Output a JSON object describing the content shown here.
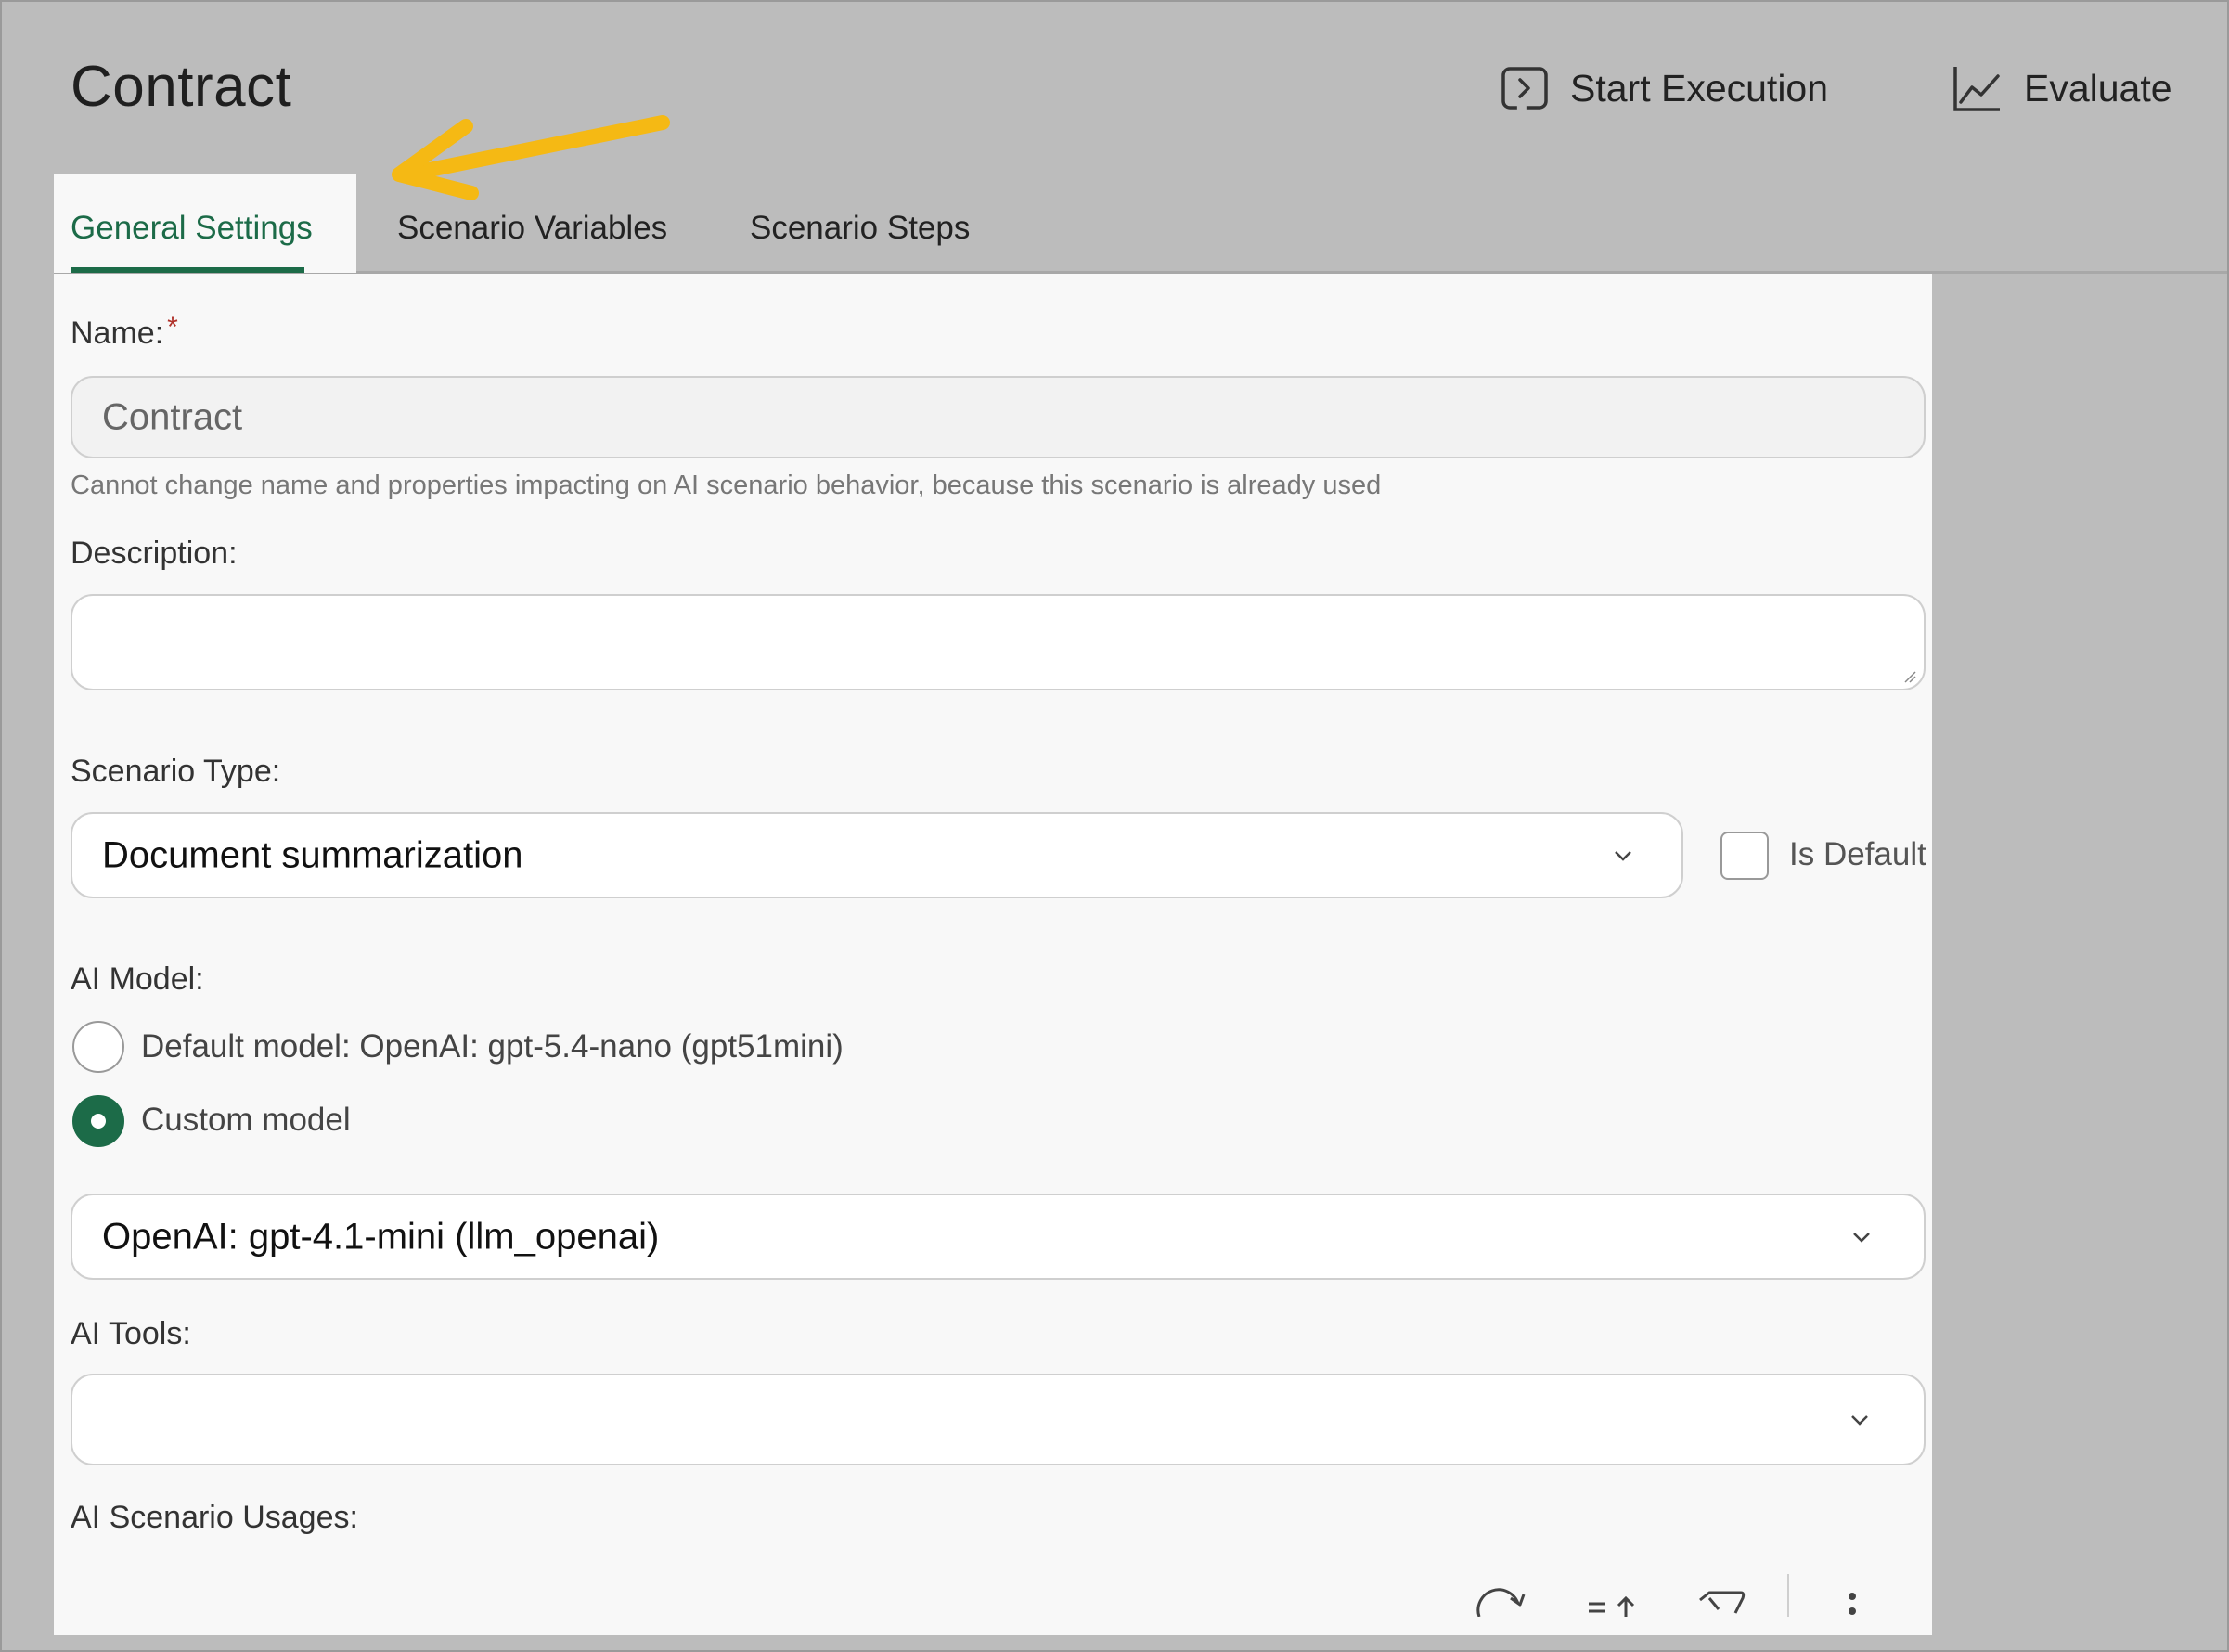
{
  "header": {
    "title": "Contract",
    "actions": {
      "start_execution": "Start Execution",
      "evaluate": "Evaluate"
    }
  },
  "tabs": {
    "general": "General Settings",
    "variables": "Scenario Variables",
    "steps": "Scenario Steps",
    "active": "General Settings"
  },
  "form": {
    "name": {
      "label": "Name:",
      "required_mark": "*",
      "value": "Contract",
      "hint": "Cannot change name and properties impacting on AI scenario behavior, because this scenario is already used"
    },
    "description": {
      "label": "Description:",
      "value": ""
    },
    "scenario_type": {
      "label": "Scenario Type:",
      "value": "Document summarization",
      "is_default_label": "Is Default",
      "is_default_checked": false
    },
    "ai_model": {
      "label": "AI Model:",
      "options": [
        {
          "label": "Default model: OpenAI: gpt-5.4-nano (gpt51mini)",
          "selected": false
        },
        {
          "label": "Custom model",
          "selected": true
        }
      ],
      "custom_value": "OpenAI: gpt-4.1-mini (llm_openai)"
    },
    "ai_tools": {
      "label": "AI Tools:",
      "value": ""
    },
    "usages": {
      "label": "AI Scenario Usages:"
    }
  },
  "toolbar_icons": [
    "refresh-icon",
    "sort-icon",
    "filter-clear-icon",
    "more-vertical-icon"
  ],
  "colors": {
    "accent": "#1c6b48",
    "annotation_arrow": "#f5b914",
    "required": "#b0322b"
  }
}
